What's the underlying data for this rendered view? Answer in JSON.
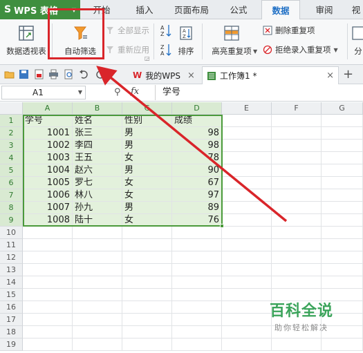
{
  "menubar": {
    "app_name": "WPS 表格",
    "tabs": [
      {
        "label": "开始"
      },
      {
        "label": "插入"
      },
      {
        "label": "页面布局"
      },
      {
        "label": "公式"
      },
      {
        "label": "数据"
      },
      {
        "label": "审阅"
      },
      {
        "label": "视"
      }
    ],
    "active_tab": "数据"
  },
  "ribbon": {
    "pivot_table": "数据透视表",
    "auto_filter": "自动筛选",
    "show_all": "全部显示",
    "reapply": "重新应用",
    "sort": "排序",
    "highlight_duplicates": "高亮重复项",
    "remove_duplicates": "删除重复项",
    "reject_duplicates": "拒绝录入重复项",
    "split_partial": "分"
  },
  "docbar": {
    "tabs": [
      {
        "label": "我的WPS"
      },
      {
        "label": "工作簿1 *"
      }
    ],
    "add_tab": "+"
  },
  "formula_bar": {
    "cell_ref": "A1",
    "fx": "fx",
    "value": "学号"
  },
  "sheet": {
    "columns": [
      "A",
      "B",
      "C",
      "D",
      "E",
      "F",
      "G"
    ],
    "rows": [
      [
        "学号",
        "姓名",
        "性别",
        "成绩"
      ],
      [
        "1001",
        "张三",
        "男",
        "98"
      ],
      [
        "1002",
        "李四",
        "男",
        "98"
      ],
      [
        "1003",
        "王五",
        "女",
        "78"
      ],
      [
        "1004",
        "赵六",
        "男",
        "90"
      ],
      [
        "1005",
        "罗七",
        "女",
        "67"
      ],
      [
        "1006",
        "林八",
        "女",
        "97"
      ],
      [
        "1007",
        "孙九",
        "男",
        "89"
      ],
      [
        "1008",
        "陆十",
        "女",
        "76"
      ]
    ],
    "row_numbers": [
      "1",
      "2",
      "3",
      "4",
      "5",
      "6",
      "7",
      "8",
      "9",
      "10",
      "11",
      "12",
      "13",
      "14",
      "15",
      "16",
      "17",
      "18",
      "19"
    ]
  },
  "watermark": {
    "title": "百科全说",
    "subtitle": "助你轻松解决"
  },
  "colors": {
    "app_green": "#3f8f3f",
    "selection_green": "#4a9a3a",
    "annotation_red": "#d9252a",
    "watermark_green": "#3aa35a"
  }
}
